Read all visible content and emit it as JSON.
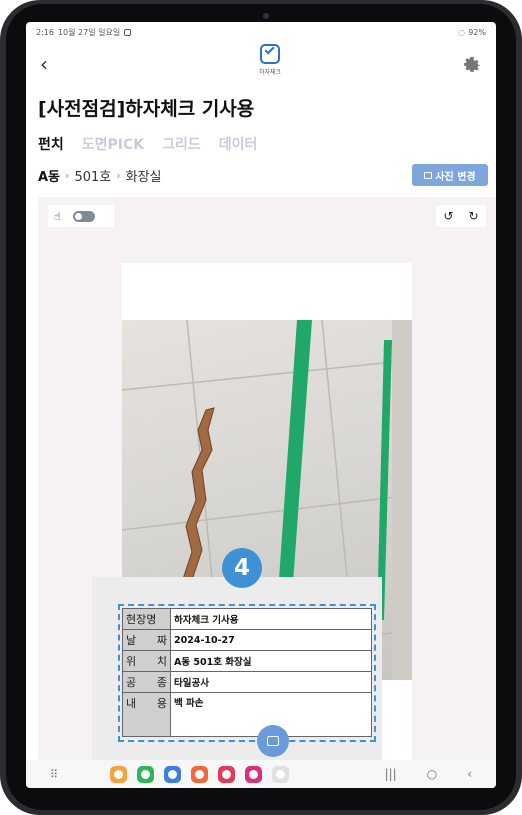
{
  "status": {
    "time": "2:16",
    "date": "10월 27일 일요일",
    "battery": "92%"
  },
  "appbar": {
    "logo_text": "하자체크",
    "icons": [
      "back-arrow-icon",
      "checkbox-logo-icon",
      "gear-icon"
    ]
  },
  "page": {
    "title": "[사전점검]하자체크 기사용"
  },
  "tabs": [
    "펀치",
    "도면PICK",
    "그리드",
    "데이터"
  ],
  "breadcrumb": {
    "building": "A동",
    "unit": "501호",
    "room": "화장실"
  },
  "photo_change_label": "사진 변경",
  "badge_number": "4",
  "info_table": [
    {
      "key": "현장명",
      "value": "하자체크 기사용"
    },
    {
      "key": "날 짜",
      "value": "2024-10-27"
    },
    {
      "key": "위 치",
      "value": "A동 501호 화장실"
    },
    {
      "key": "공 종",
      "value": "타일공사"
    },
    {
      "key": "내 용",
      "value": "백 파손"
    }
  ],
  "colors": {
    "accent": "#3d91d4",
    "button": "#7fa6dc",
    "tape": "#1fa867",
    "crack": "#a06a42"
  }
}
